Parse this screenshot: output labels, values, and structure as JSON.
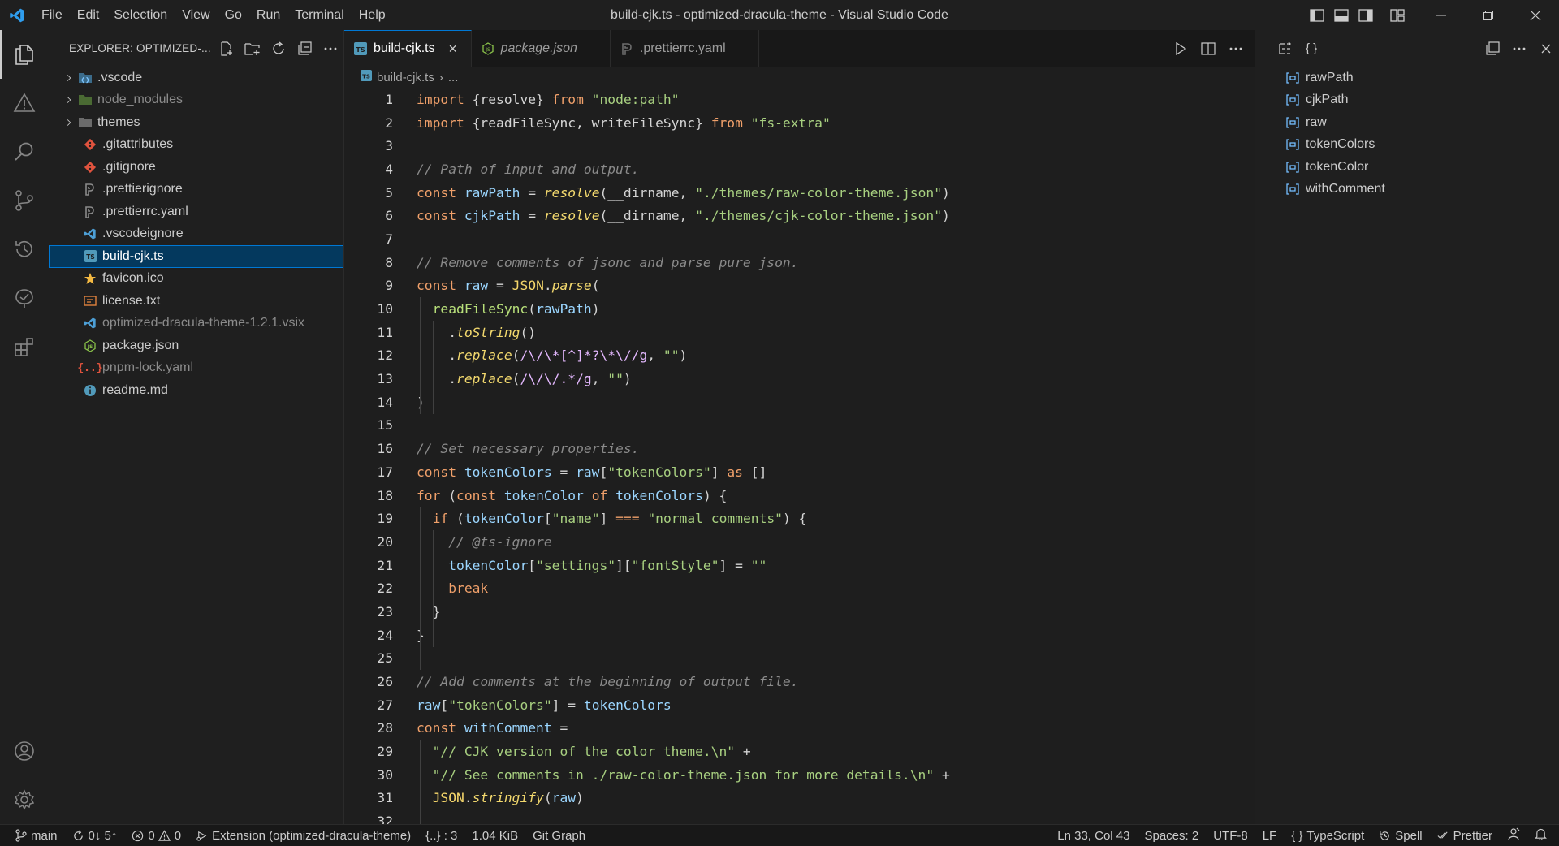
{
  "window": {
    "title": "build-cjk.ts - optimized-dracula-theme - Visual Studio Code",
    "menu": [
      "File",
      "Edit",
      "Selection",
      "View",
      "Go",
      "Run",
      "Terminal",
      "Help"
    ]
  },
  "explorer": {
    "title": "EXPLORER: OPTIMIZED-...",
    "items": [
      {
        "name": ".vscode",
        "type": "folder",
        "icon": "vscode-folder-icon"
      },
      {
        "name": "node_modules",
        "type": "folder",
        "icon": "node-folder-icon"
      },
      {
        "name": "themes",
        "type": "folder",
        "icon": "folder-icon"
      },
      {
        "name": ".gitattributes",
        "type": "file",
        "icon": "git-icon"
      },
      {
        "name": ".gitignore",
        "type": "file",
        "icon": "git-icon"
      },
      {
        "name": ".prettierignore",
        "type": "file",
        "icon": "prettier-icon"
      },
      {
        "name": ".prettierrc.yaml",
        "type": "file",
        "icon": "prettier-icon"
      },
      {
        "name": ".vscodeignore",
        "type": "file",
        "icon": "vscode-icon"
      },
      {
        "name": "build-cjk.ts",
        "type": "file",
        "icon": "typescript-icon",
        "selected": true
      },
      {
        "name": "favicon.ico",
        "type": "file",
        "icon": "star-icon"
      },
      {
        "name": "license.txt",
        "type": "file",
        "icon": "license-icon"
      },
      {
        "name": "optimized-dracula-theme-1.2.1.vsix",
        "type": "file",
        "icon": "vscode-icon"
      },
      {
        "name": "package.json",
        "type": "file",
        "icon": "nodejs-icon"
      },
      {
        "name": "pnpm-lock.yaml",
        "type": "file",
        "icon": "braces-icon"
      },
      {
        "name": "readme.md",
        "type": "file",
        "icon": "info-icon"
      }
    ]
  },
  "tabs": [
    {
      "label": "build-cjk.ts",
      "active": true,
      "italic": false
    },
    {
      "label": "package.json",
      "active": false,
      "italic": true
    },
    {
      "label": ".prettierrc.yaml",
      "active": false,
      "italic": false
    }
  ],
  "breadcrumb": {
    "file": "build-cjk.ts",
    "rest": "..."
  },
  "code": {
    "line_numbers": [
      "1",
      "2",
      "3",
      "4",
      "5",
      "6",
      "7",
      "8",
      "9",
      "10",
      "11",
      "12",
      "13",
      "14",
      "15",
      "16",
      "17",
      "18",
      "19",
      "20",
      "21",
      "22",
      "23",
      "24",
      "25",
      "26",
      "27",
      "28",
      "29",
      "30",
      "31",
      "32"
    ],
    "lines": [
      [
        [
          "k",
          "import "
        ],
        [
          "p",
          "{resolve} "
        ],
        [
          "k",
          "from "
        ],
        [
          "s",
          "\"node:path\""
        ]
      ],
      [
        [
          "k",
          "import "
        ],
        [
          "p",
          "{readFileSync, writeFileSync} "
        ],
        [
          "k",
          "from "
        ],
        [
          "s",
          "\"fs-extra\""
        ]
      ],
      [],
      [
        [
          "c",
          "// Path of input and output."
        ]
      ],
      [
        [
          "k",
          "const "
        ],
        [
          "v",
          "rawPath"
        ],
        [
          "p",
          " = "
        ],
        [
          "f",
          "resolve"
        ],
        [
          "p",
          "(__dirname, "
        ],
        [
          "s",
          "\"./themes/raw-color-theme.json\""
        ],
        [
          "p",
          ")"
        ]
      ],
      [
        [
          "k",
          "const "
        ],
        [
          "v",
          "cjkPath"
        ],
        [
          "p",
          " = "
        ],
        [
          "f",
          "resolve"
        ],
        [
          "p",
          "(__dirname, "
        ],
        [
          "s",
          "\"./themes/cjk-color-theme.json\""
        ],
        [
          "p",
          ")"
        ]
      ],
      [],
      [
        [
          "c",
          "// Remove comments of jsonc and parse pure json."
        ]
      ],
      [
        [
          "k",
          "const "
        ],
        [
          "v",
          "raw"
        ],
        [
          "p",
          " = "
        ],
        [
          "t",
          "JSON"
        ],
        [
          "p",
          "."
        ],
        [
          "f",
          "parse"
        ],
        [
          "p",
          "("
        ]
      ],
      [
        [
          "p",
          "  "
        ],
        [
          "fn",
          "readFileSync"
        ],
        [
          "p",
          "("
        ],
        [
          "v",
          "rawPath"
        ],
        [
          "p",
          ")"
        ]
      ],
      [
        [
          "p",
          "    ."
        ],
        [
          "f",
          "toString"
        ],
        [
          "p",
          "()"
        ]
      ],
      [
        [
          "p",
          "    ."
        ],
        [
          "f",
          "replace"
        ],
        [
          "p",
          "("
        ],
        [
          "r",
          "/\\/\\*[^]*?\\*\\//g"
        ],
        [
          "p",
          ", "
        ],
        [
          "s",
          "\"\""
        ],
        [
          "p",
          ")"
        ]
      ],
      [
        [
          "p",
          "    ."
        ],
        [
          "f",
          "replace"
        ],
        [
          "p",
          "("
        ],
        [
          "r",
          "/\\/\\/.*/g"
        ],
        [
          "p",
          ", "
        ],
        [
          "s",
          "\"\""
        ],
        [
          "p",
          ")"
        ]
      ],
      [
        [
          "p",
          ")"
        ]
      ],
      [],
      [
        [
          "c",
          "// Set necessary properties."
        ]
      ],
      [
        [
          "k",
          "const "
        ],
        [
          "v",
          "tokenColors"
        ],
        [
          "p",
          " = "
        ],
        [
          "v",
          "raw"
        ],
        [
          "p",
          "["
        ],
        [
          "s",
          "\"tokenColors\""
        ],
        [
          "p",
          "] "
        ],
        [
          "k",
          "as "
        ],
        [
          "p",
          "[]"
        ]
      ],
      [
        [
          "k",
          "for "
        ],
        [
          "p",
          "("
        ],
        [
          "k",
          "const "
        ],
        [
          "v",
          "tokenColor "
        ],
        [
          "k",
          "of "
        ],
        [
          "v",
          "tokenColors"
        ],
        [
          "p",
          ") {"
        ]
      ],
      [
        [
          "p",
          "  "
        ],
        [
          "k",
          "if "
        ],
        [
          "p",
          "("
        ],
        [
          "v",
          "tokenColor"
        ],
        [
          "p",
          "["
        ],
        [
          "s",
          "\"name\""
        ],
        [
          "p",
          "] "
        ],
        [
          "k",
          "=== "
        ],
        [
          "s",
          "\"normal comments\""
        ],
        [
          "p",
          ") {"
        ]
      ],
      [
        [
          "p",
          "    "
        ],
        [
          "c",
          "// @ts-ignore"
        ]
      ],
      [
        [
          "p",
          "    "
        ],
        [
          "v",
          "tokenColor"
        ],
        [
          "p",
          "["
        ],
        [
          "s",
          "\"settings\""
        ],
        [
          "p",
          "]["
        ],
        [
          "s",
          "\"fontStyle\""
        ],
        [
          "p",
          "] = "
        ],
        [
          "s",
          "\"\""
        ]
      ],
      [
        [
          "p",
          "    "
        ],
        [
          "k",
          "break"
        ]
      ],
      [
        [
          "p",
          "  }"
        ]
      ],
      [
        [
          "p",
          "}"
        ]
      ],
      [],
      [
        [
          "c",
          "// Add comments at the beginning of output file."
        ]
      ],
      [
        [
          "v",
          "raw"
        ],
        [
          "p",
          "["
        ],
        [
          "s",
          "\"tokenColors\""
        ],
        [
          "p",
          "] = "
        ],
        [
          "v",
          "tokenColors"
        ]
      ],
      [
        [
          "k",
          "const "
        ],
        [
          "v",
          "withComment"
        ],
        [
          "p",
          " ="
        ]
      ],
      [
        [
          "p",
          "  "
        ],
        [
          "s",
          "\"// CJK version of the color theme.\\n\""
        ],
        [
          "p",
          " +"
        ]
      ],
      [
        [
          "p",
          "  "
        ],
        [
          "s",
          "\"// See comments in ./raw-color-theme.json for more details.\\n\""
        ],
        [
          "p",
          " +"
        ]
      ],
      [
        [
          "p",
          "  "
        ],
        [
          "t",
          "JSON"
        ],
        [
          "p",
          "."
        ],
        [
          "f",
          "stringify"
        ],
        [
          "p",
          "("
        ],
        [
          "v",
          "raw"
        ],
        [
          "p",
          ")"
        ]
      ],
      []
    ]
  },
  "outline": {
    "items": [
      "rawPath",
      "cjkPath",
      "raw",
      "tokenColors",
      "tokenColor",
      "withComment"
    ]
  },
  "status": {
    "branch": "main",
    "sync": "0↓ 5↑",
    "errors": "0",
    "warnings": "0",
    "extension": "Extension (optimized-dracula-theme)",
    "brackets": "{..} : 3",
    "filesize": "1.04 KiB",
    "gitgraph": "Git Graph",
    "position": "Ln 33, Col 43",
    "spaces": "Spaces: 2",
    "encoding": "UTF-8",
    "eol": "LF",
    "language": "TypeScript",
    "spell": "Spell",
    "prettier": "Prettier"
  },
  "colors": {
    "accent": "#0078d4",
    "selection": "#04395e",
    "keyword": "#f0a06a",
    "string": "#a8d080",
    "variable": "#9bd6ff",
    "function": "#f3d96e",
    "comment": "#8a8a8a"
  }
}
